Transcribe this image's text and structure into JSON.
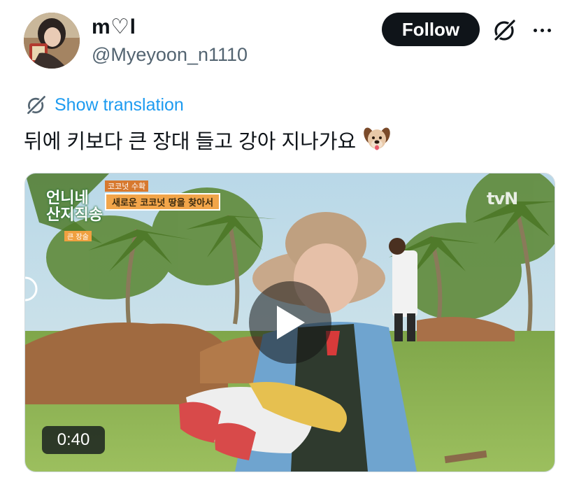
{
  "author": {
    "display_name": "m♡l",
    "handle": "@Myeyoon_n1110"
  },
  "actions": {
    "follow_label": "Follow"
  },
  "translation": {
    "label": "Show translation"
  },
  "tweet": {
    "text": "뒤에 키보다 큰 장대 들고 강아 지나가요",
    "emoji": "🐶"
  },
  "video": {
    "duration": "0:40",
    "overlay_top": "코코넛 수확",
    "overlay_caption": "새로운 코코넛 땅을 찾아서",
    "show_title_line1": "언니네",
    "show_title_line2": "산지직송",
    "show_tag": "큰 장술",
    "channel": "tvN"
  },
  "colors": {
    "link": "#1d9bf0",
    "secondary_text": "#536471",
    "follow_bg": "#0f1419"
  }
}
